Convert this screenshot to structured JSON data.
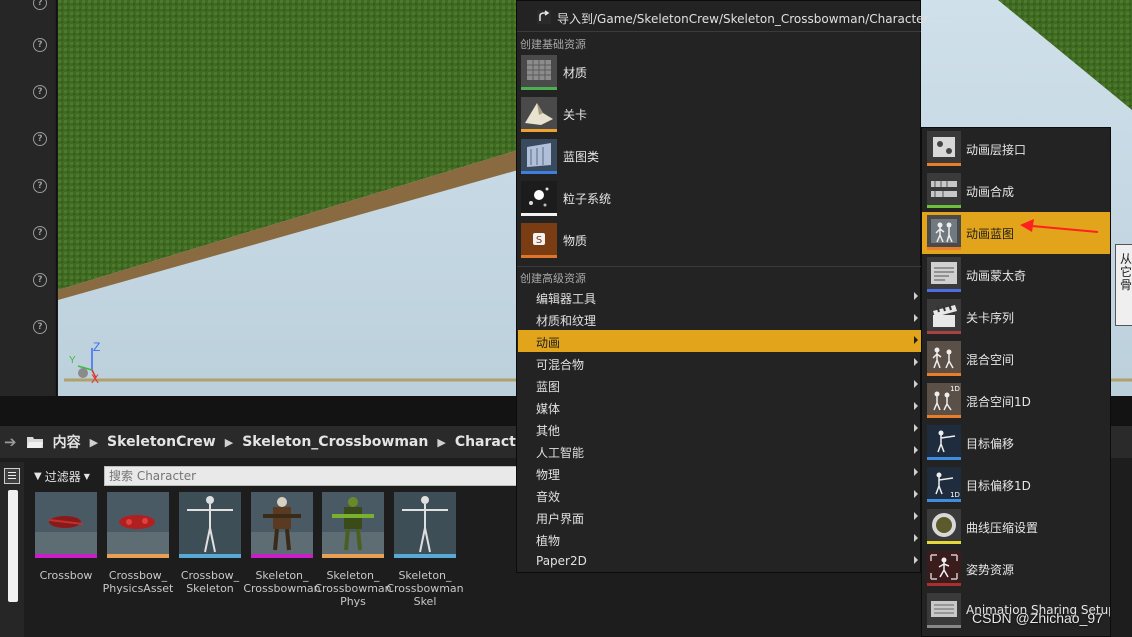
{
  "context_menu": {
    "import_item": "导入到/Game/SkeletonCrew/Skeleton_Crossbowman/Character......",
    "basic_header": "创建基础资源",
    "basic_items": [
      {
        "label": "材质",
        "icon": "material-icon",
        "color": "#4caf50"
      },
      {
        "label": "关卡",
        "icon": "level-icon",
        "color": "#f0a030"
      },
      {
        "label": "蓝图类",
        "icon": "blueprint-class-icon",
        "color": "#3f7fe0"
      },
      {
        "label": "粒子系统",
        "icon": "particle-system-icon",
        "color": "#f2f2f2"
      },
      {
        "label": "物质",
        "icon": "substance-icon",
        "color": "#e0742a"
      }
    ],
    "advanced_header": "创建高级资源",
    "advanced_items": [
      {
        "label": "编辑器工具"
      },
      {
        "label": "材质和纹理"
      },
      {
        "label": "动画",
        "active": true
      },
      {
        "label": "可混合物"
      },
      {
        "label": "蓝图"
      },
      {
        "label": "媒体"
      },
      {
        "label": "其他"
      },
      {
        "label": "人工智能"
      },
      {
        "label": "物理"
      },
      {
        "label": "音效"
      },
      {
        "label": "用户界面"
      },
      {
        "label": "植物"
      },
      {
        "label": "Paper2D"
      }
    ]
  },
  "animation_submenu": {
    "items": [
      {
        "label": "动画层接口",
        "icon": "anim-layer-interface-icon",
        "color": "#e87d2a"
      },
      {
        "label": "动画合成",
        "icon": "anim-composite-icon",
        "color": "#6fbf3c"
      },
      {
        "label": "动画蓝图",
        "icon": "anim-blueprint-icon",
        "color": "#e87d2a",
        "active": true
      },
      {
        "label": "动画蒙太奇",
        "icon": "anim-montage-icon",
        "color": "#4b6ee0"
      },
      {
        "label": "关卡序列",
        "icon": "level-sequence-icon",
        "color": "#aa4040"
      },
      {
        "label": "混合空间",
        "icon": "blend-space-icon",
        "color": "#e87d2a"
      },
      {
        "label": "混合空间1D",
        "icon": "blend-space-1d-icon",
        "color": "#e87d2a"
      },
      {
        "label": "目标偏移",
        "icon": "aim-offset-icon",
        "color": "#3d8de0"
      },
      {
        "label": "目标偏移1D",
        "icon": "aim-offset-1d-icon",
        "color": "#3d8de0"
      },
      {
        "label": "曲线压缩设置",
        "icon": "curve-compression-icon",
        "color": "#e6d63a"
      },
      {
        "label": "姿势资源",
        "icon": "pose-asset-icon",
        "color": "#aa3030"
      },
      {
        "label": "Animation Sharing Setup",
        "icon": "animation-sharing-icon",
        "color": "#888888"
      }
    ]
  },
  "tooltip": {
    "text": "从\n它\n骨"
  },
  "content_browser": {
    "breadcrumb": [
      "内容",
      "SkeletonCrew",
      "Skeleton_Crossbowman",
      "Character"
    ],
    "filter_label": "过滤器",
    "search_placeholder": "搜索 Character",
    "assets": [
      {
        "label": "Crossbow",
        "color": "#c81ec8"
      },
      {
        "label": "Crossbow_\nPhysicsAsset",
        "color": "#e8a054"
      },
      {
        "label": "Crossbow_\nSkeleton",
        "color": "#59a9d6"
      },
      {
        "label": "Skeleton_\nCrossbowman",
        "color": "#c81ec8"
      },
      {
        "label": "Skeleton_\nCrossbowman\nPhys",
        "color": "#e8a054"
      },
      {
        "label": "Skeleton_\nCrossbowman\nSkel",
        "color": "#59a9d6"
      }
    ]
  },
  "viewport": {
    "axis_z": "Z",
    "axis_x": "X",
    "axis_y": "Y"
  },
  "watermark": "CSDN @Zhichao_97"
}
